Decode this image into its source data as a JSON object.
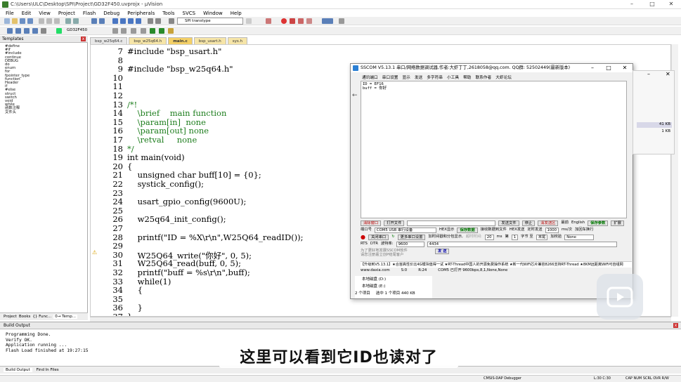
{
  "window": {
    "title": "C:\\Users\\ULC\\Desktop\\SPI\\Project\\GD32F450.uvprojx - µVision"
  },
  "menu": [
    "File",
    "Edit",
    "View",
    "Project",
    "Flash",
    "Debug",
    "Peripherals",
    "Tools",
    "SVCS",
    "Window",
    "Help"
  ],
  "toolbar": {
    "target_select": "GD32F450",
    "find_box": "SPI transtype"
  },
  "templates_panel": {
    "title": "Templates",
    "items": [
      "#define",
      "#if",
      "#include",
      "continue",
      "DEBUG",
      "do",
      "enum",
      "for",
      "fpointer_type",
      "function",
      "Header",
      "if",
      "#else",
      "struct",
      "switch",
      "void",
      "while",
      "函数注释",
      "文件头"
    ],
    "tabs": [
      "Project",
      "Books",
      "{} Func...",
      "0→ Temp..."
    ]
  },
  "file_tabs": [
    "bsp_w25q64.c",
    "bsp_w25q64.h",
    "main.c",
    "bsp_usart.h",
    "sys.h"
  ],
  "editor": {
    "lines": [
      {
        "n": "7",
        "t": "#include \"bsp_usart.h\""
      },
      {
        "n": "8",
        "t": ""
      },
      {
        "n": "9",
        "t": "#include \"bsp_w25q64.h\""
      },
      {
        "n": "10",
        "t": ""
      },
      {
        "n": "11",
        "t": ""
      },
      {
        "n": "12",
        "t": ""
      },
      {
        "n": "13",
        "t": "/*!"
      },
      {
        "n": "14",
        "t": "    \\brief    main function"
      },
      {
        "n": "15",
        "t": "    \\param[in]  none"
      },
      {
        "n": "16",
        "t": "    \\param[out] none"
      },
      {
        "n": "17",
        "t": "    \\retval     none"
      },
      {
        "n": "18",
        "t": "*/"
      },
      {
        "n": "19",
        "t": "int main(void)"
      },
      {
        "n": "20",
        "t": "{"
      },
      {
        "n": "21",
        "t": "    unsigned char buff[10] = {0};"
      },
      {
        "n": "22",
        "t": "    systick_config();"
      },
      {
        "n": "23",
        "t": ""
      },
      {
        "n": "24",
        "t": "    usart_gpio_config(9600U);"
      },
      {
        "n": "25",
        "t": ""
      },
      {
        "n": "26",
        "t": "    w25q64_init_config();"
      },
      {
        "n": "27",
        "t": ""
      },
      {
        "n": "28",
        "t": "    printf(\"ID = %X\\r\\n\",W25Q64_readID());"
      },
      {
        "n": "29",
        "t": ""
      },
      {
        "n": "30",
        "t": "    W25Q64_write(\"你好\", 0, 5);"
      },
      {
        "n": "31",
        "t": "    W25Q64_read(buff, 0, 5);"
      },
      {
        "n": "32",
        "t": "    printf(\"buff = %s\\r\\n\",buff);"
      },
      {
        "n": "33",
        "t": "    while(1)"
      },
      {
        "n": "34",
        "t": "    {"
      },
      {
        "n": "35",
        "t": ""
      },
      {
        "n": "36",
        "t": "    }"
      },
      {
        "n": "37",
        "t": "}"
      }
    ]
  },
  "build_output": {
    "title": "Build Output",
    "text": "Programming Done.\nVerify OK.\nApplication running ...\nFlash Load finished at 19:27:15",
    "tabs": [
      "Build Output",
      "Find In Files"
    ]
  },
  "status": {
    "debugger": "CMSIS-DAP Debugger",
    "position": "L:30 C:30",
    "flags": "CAP  NUM  SCRL  OVR  R/W"
  },
  "subtitle": "这里可以看到它ID也读对了",
  "sscom": {
    "title": "SSCOM V5.13.1 串口/网络数据调试器,作者:大虾丁丁,2618058@qq.com. QQ群: 52502449(最新版本)",
    "menu": [
      "通讯端口",
      "串口设置",
      "显示",
      "发送",
      "多字符串",
      "小工具",
      "帮助",
      "联系作者",
      "大虾论坛"
    ],
    "output": "ID = EF16\nbuff = 你好",
    "row1": {
      "clear": "清除窗口",
      "open_file": "打开文件",
      "send_file": "发送文件",
      "stop": "停止",
      "clear_send": "清发送区",
      "top": "最前",
      "english": "English",
      "save_params": "保存参数",
      "expand": "扩展"
    },
    "row2": {
      "port_label": "端口号",
      "port": "COM5 USB 串行设备",
      "hex_show": "HEX显示",
      "save_data": "保存数据",
      "recv_to_file": "接收数据到文件",
      "hex_send": "HEX发送",
      "timed_send": "定时发送",
      "interval": "1000",
      "interval_unit": "ms/次",
      "add_crlf": "加回车换行"
    },
    "row3": {
      "close_port": "关闭串口",
      "more_settings": "更多串口设置",
      "add_timestamp": "加时间戳和分包显示,",
      "timeout_label": "超时时间:",
      "timeout": "20",
      "timeout_unit": "ms",
      "byte_label": "第",
      "byte_no": "1",
      "byte_unit": "字节 至",
      "byte_end": "末尾",
      "checksum_label": "加校验",
      "checksum": "None"
    },
    "row4": {
      "rts": "RTS",
      "dtr": "DTR",
      "baud_label": "波特率:",
      "baud": "9600",
      "send_text": "4434"
    },
    "row5": {
      "tip": "为了更好地发展SSCOM软件\n请您注册嘉立创P结尾客户",
      "send": "发 送"
    },
    "ad": "【升级到V5.13.1】★合宙高性价比4G模块值得一试 ★RT-Thread中国人的开源免费操作系统 ★新一代WiFi芯片兼容8266支持RT-Thread ★8KM远距离WiFi可自组网",
    "statusbar": {
      "site": "www.daxia.com",
      "s": "S:0",
      "r": "R:24",
      "port": "COM5 已打开  9600bps,8,1,None,None"
    }
  },
  "explorer": {
    "drives": [
      "本地磁盘 (D:)",
      "本地磁盘 (E:)"
    ],
    "count": "2 个项目",
    "selected": "选中 1 个项目  440 KB",
    "sizes": [
      "41 KB",
      "1 KB"
    ]
  }
}
